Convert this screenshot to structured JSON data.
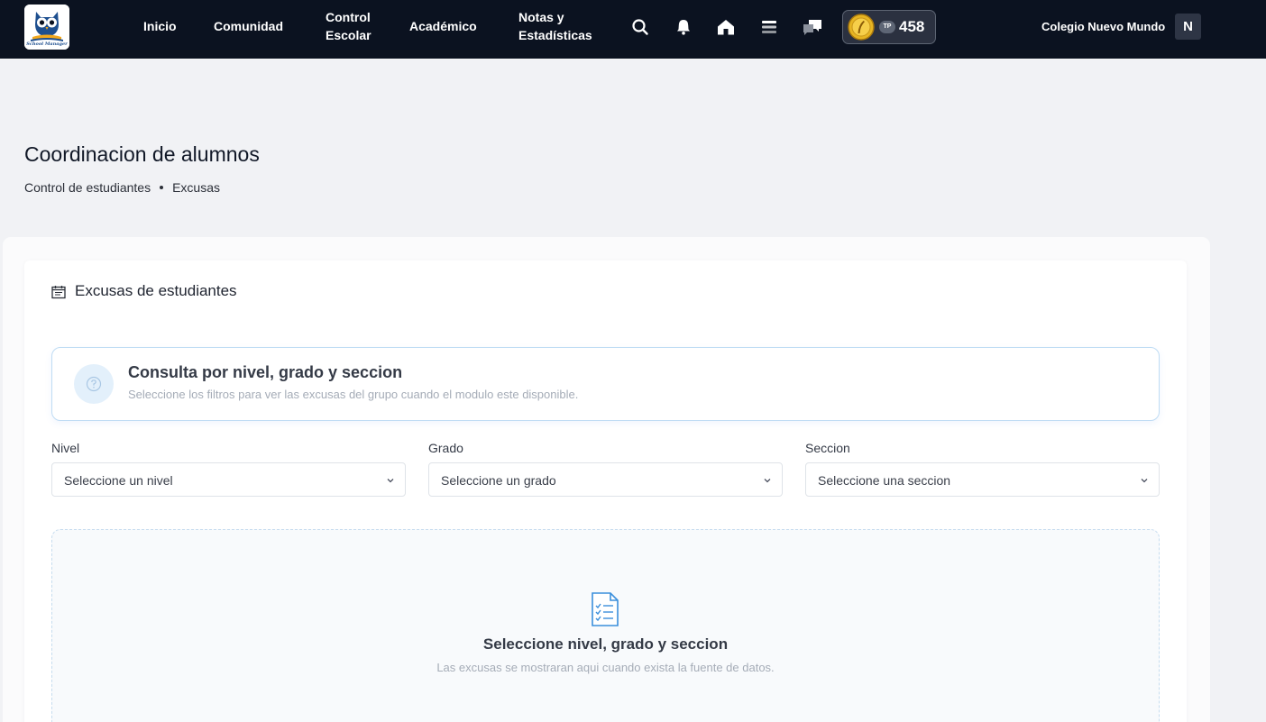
{
  "navbar": {
    "logo_text": "School Manager",
    "links": [
      "Inicio",
      "Comunidad",
      "Control Escolar",
      "Académico",
      "Notas y Estadísticas"
    ],
    "icons": [
      "search-icon",
      "bell-icon",
      "home-icon",
      "menu-icon",
      "chat-icon"
    ],
    "points": {
      "badge": "TP",
      "value": "458"
    },
    "school_name": "Colegio Nuevo Mundo",
    "user_initial": "N"
  },
  "page": {
    "title": "Coordinacion de alumnos",
    "breadcrumb": [
      "Control de estudiantes",
      "Excusas"
    ]
  },
  "card": {
    "title": "Excusas de estudiantes",
    "info": {
      "title": "Consulta por nivel, grado y seccion",
      "subtitle": "Seleccione los filtros para ver las excusas del grupo cuando el modulo este disponible."
    },
    "filters": [
      {
        "label": "Nivel",
        "value": "Seleccione un nivel"
      },
      {
        "label": "Grado",
        "value": "Seleccione un grado"
      },
      {
        "label": "Seccion",
        "value": "Seleccione una seccion"
      }
    ],
    "empty": {
      "title": "Seleccione nivel, grado y seccion",
      "subtitle": "Las excusas se mostraran aqui cuando exista la fuente de datos."
    }
  },
  "colors": {
    "navbar_bg": "#0b1220",
    "page_bg": "#f1f2f5",
    "accent_blue": "#3b8fdc",
    "coin_gold": "#e6b422"
  }
}
